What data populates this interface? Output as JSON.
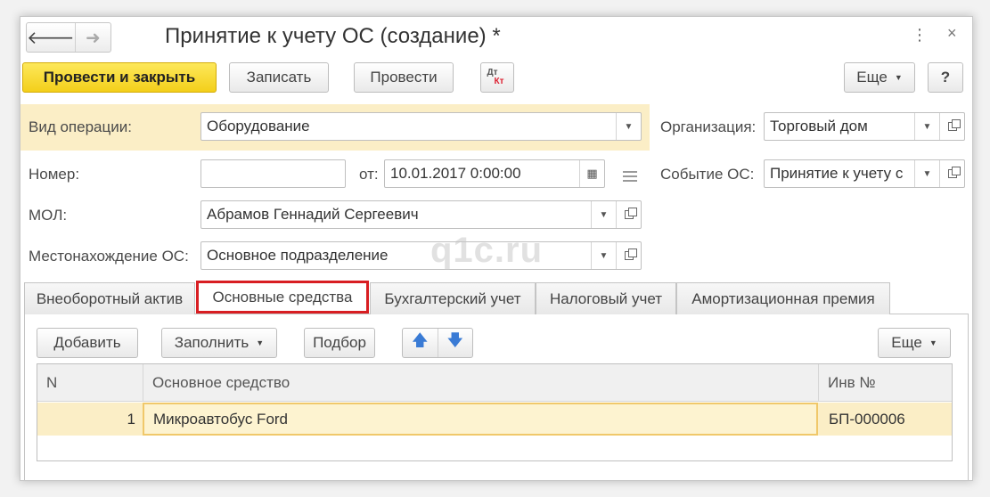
{
  "window": {
    "title": "Принятие к учету ОС (создание) *",
    "back_glyph": "🡐",
    "forward_glyph": "➜",
    "menu_glyph": "⋮",
    "close_glyph": "×"
  },
  "toolbar": {
    "post_close": "Провести и закрыть",
    "save": "Записать",
    "post": "Провести",
    "dt": "Дт",
    "kt": "Кт",
    "more": "Еще",
    "help": "?"
  },
  "form": {
    "operation_label": "Вид операции:",
    "operation_value": "Оборудование",
    "org_label": "Организация:",
    "org_value": "Торговый дом",
    "number_label": "Номер:",
    "number_value": "",
    "date_from_label": "от:",
    "date_value": "10.01.2017  0:00:00",
    "event_label": "Событие ОС:",
    "event_value": "Принятие к учету с",
    "mol_label": "МОЛ:",
    "mol_value": "Абрамов Геннадий Сергеевич",
    "location_label": "Местонахождение ОС:",
    "location_value": "Основное подразделение"
  },
  "watermark": "q1c.ru",
  "tabs": [
    {
      "label": "Внеоборотный актив"
    },
    {
      "label": "Основные средства"
    },
    {
      "label": "Бухгалтерский учет"
    },
    {
      "label": "Налоговый учет"
    },
    {
      "label": "Амортизационная премия"
    }
  ],
  "table_toolbar": {
    "add": "Добавить",
    "fill": "Заполнить",
    "select": "Подбор",
    "up_glyph": "🡅",
    "down_glyph": "🡇",
    "more": "Еще"
  },
  "table": {
    "columns": [
      "N",
      "Основное средство",
      "Инв №"
    ],
    "rows": [
      {
        "n": "1",
        "asset": "Микроавтобус Ford",
        "inv": "БП-000006"
      }
    ]
  },
  "colors": {
    "primary_button": "#f3cf1a",
    "highlight_row": "#fbeec6",
    "active_tab_border": "#d81e22"
  }
}
